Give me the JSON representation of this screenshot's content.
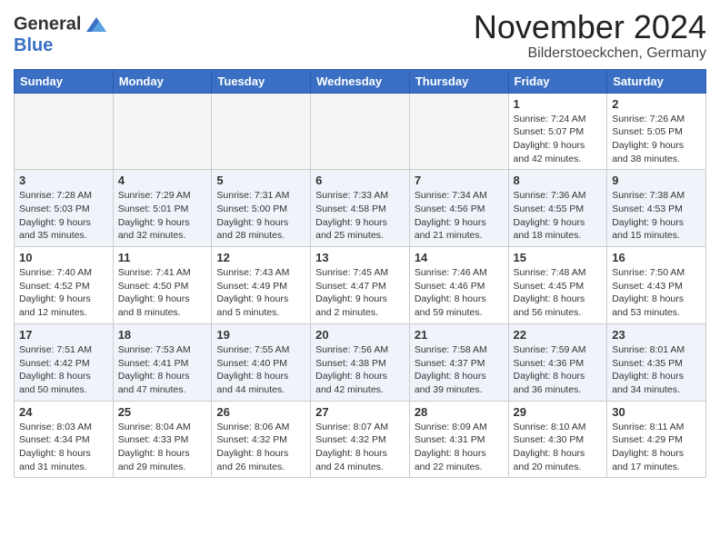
{
  "header": {
    "logo_line1": "General",
    "logo_line2": "Blue",
    "month_title": "November 2024",
    "location": "Bilderstoeckchen, Germany"
  },
  "days_of_week": [
    "Sunday",
    "Monday",
    "Tuesday",
    "Wednesday",
    "Thursday",
    "Friday",
    "Saturday"
  ],
  "weeks": [
    [
      {
        "day": "",
        "info": "",
        "empty": true
      },
      {
        "day": "",
        "info": "",
        "empty": true
      },
      {
        "day": "",
        "info": "",
        "empty": true
      },
      {
        "day": "",
        "info": "",
        "empty": true
      },
      {
        "day": "",
        "info": "",
        "empty": true
      },
      {
        "day": "1",
        "info": "Sunrise: 7:24 AM\nSunset: 5:07 PM\nDaylight: 9 hours and 42 minutes."
      },
      {
        "day": "2",
        "info": "Sunrise: 7:26 AM\nSunset: 5:05 PM\nDaylight: 9 hours and 38 minutes."
      }
    ],
    [
      {
        "day": "3",
        "info": "Sunrise: 7:28 AM\nSunset: 5:03 PM\nDaylight: 9 hours and 35 minutes."
      },
      {
        "day": "4",
        "info": "Sunrise: 7:29 AM\nSunset: 5:01 PM\nDaylight: 9 hours and 32 minutes."
      },
      {
        "day": "5",
        "info": "Sunrise: 7:31 AM\nSunset: 5:00 PM\nDaylight: 9 hours and 28 minutes."
      },
      {
        "day": "6",
        "info": "Sunrise: 7:33 AM\nSunset: 4:58 PM\nDaylight: 9 hours and 25 minutes."
      },
      {
        "day": "7",
        "info": "Sunrise: 7:34 AM\nSunset: 4:56 PM\nDaylight: 9 hours and 21 minutes."
      },
      {
        "day": "8",
        "info": "Sunrise: 7:36 AM\nSunset: 4:55 PM\nDaylight: 9 hours and 18 minutes."
      },
      {
        "day": "9",
        "info": "Sunrise: 7:38 AM\nSunset: 4:53 PM\nDaylight: 9 hours and 15 minutes."
      }
    ],
    [
      {
        "day": "10",
        "info": "Sunrise: 7:40 AM\nSunset: 4:52 PM\nDaylight: 9 hours and 12 minutes."
      },
      {
        "day": "11",
        "info": "Sunrise: 7:41 AM\nSunset: 4:50 PM\nDaylight: 9 hours and 8 minutes."
      },
      {
        "day": "12",
        "info": "Sunrise: 7:43 AM\nSunset: 4:49 PM\nDaylight: 9 hours and 5 minutes."
      },
      {
        "day": "13",
        "info": "Sunrise: 7:45 AM\nSunset: 4:47 PM\nDaylight: 9 hours and 2 minutes."
      },
      {
        "day": "14",
        "info": "Sunrise: 7:46 AM\nSunset: 4:46 PM\nDaylight: 8 hours and 59 minutes."
      },
      {
        "day": "15",
        "info": "Sunrise: 7:48 AM\nSunset: 4:45 PM\nDaylight: 8 hours and 56 minutes."
      },
      {
        "day": "16",
        "info": "Sunrise: 7:50 AM\nSunset: 4:43 PM\nDaylight: 8 hours and 53 minutes."
      }
    ],
    [
      {
        "day": "17",
        "info": "Sunrise: 7:51 AM\nSunset: 4:42 PM\nDaylight: 8 hours and 50 minutes."
      },
      {
        "day": "18",
        "info": "Sunrise: 7:53 AM\nSunset: 4:41 PM\nDaylight: 8 hours and 47 minutes."
      },
      {
        "day": "19",
        "info": "Sunrise: 7:55 AM\nSunset: 4:40 PM\nDaylight: 8 hours and 44 minutes."
      },
      {
        "day": "20",
        "info": "Sunrise: 7:56 AM\nSunset: 4:38 PM\nDaylight: 8 hours and 42 minutes."
      },
      {
        "day": "21",
        "info": "Sunrise: 7:58 AM\nSunset: 4:37 PM\nDaylight: 8 hours and 39 minutes."
      },
      {
        "day": "22",
        "info": "Sunrise: 7:59 AM\nSunset: 4:36 PM\nDaylight: 8 hours and 36 minutes."
      },
      {
        "day": "23",
        "info": "Sunrise: 8:01 AM\nSunset: 4:35 PM\nDaylight: 8 hours and 34 minutes."
      }
    ],
    [
      {
        "day": "24",
        "info": "Sunrise: 8:03 AM\nSunset: 4:34 PM\nDaylight: 8 hours and 31 minutes."
      },
      {
        "day": "25",
        "info": "Sunrise: 8:04 AM\nSunset: 4:33 PM\nDaylight: 8 hours and 29 minutes."
      },
      {
        "day": "26",
        "info": "Sunrise: 8:06 AM\nSunset: 4:32 PM\nDaylight: 8 hours and 26 minutes."
      },
      {
        "day": "27",
        "info": "Sunrise: 8:07 AM\nSunset: 4:32 PM\nDaylight: 8 hours and 24 minutes."
      },
      {
        "day": "28",
        "info": "Sunrise: 8:09 AM\nSunset: 4:31 PM\nDaylight: 8 hours and 22 minutes."
      },
      {
        "day": "29",
        "info": "Sunrise: 8:10 AM\nSunset: 4:30 PM\nDaylight: 8 hours and 20 minutes."
      },
      {
        "day": "30",
        "info": "Sunrise: 8:11 AM\nSunset: 4:29 PM\nDaylight: 8 hours and 17 minutes."
      }
    ]
  ]
}
